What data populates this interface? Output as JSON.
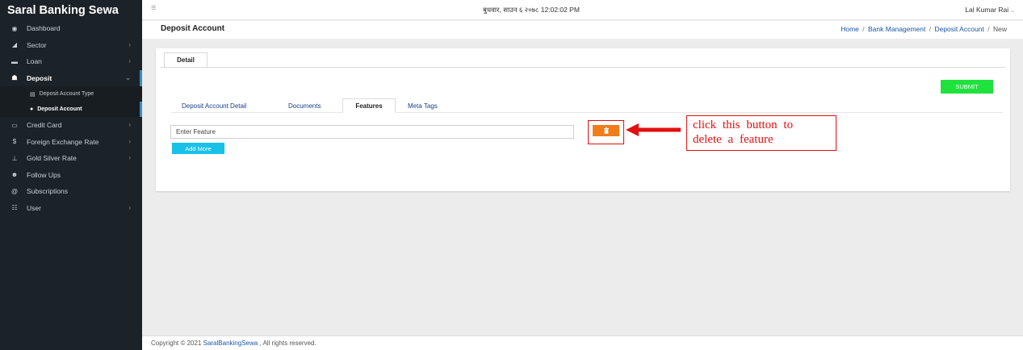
{
  "brand": "Saral Banking Sewa",
  "sidebar": {
    "items": [
      {
        "label": "Dashboard",
        "icon": "dashboard-icon"
      },
      {
        "label": "Sector",
        "icon": "sector-icon"
      },
      {
        "label": "Loan",
        "icon": "loan-icon"
      },
      {
        "label": "Deposit",
        "icon": "deposit-icon"
      },
      {
        "label": "Credit Card",
        "icon": "credit-card-icon"
      },
      {
        "label": "Foreign Exchange Rate",
        "icon": "dollar-icon"
      },
      {
        "label": "Gold Silver Rate",
        "icon": "gold-icon"
      },
      {
        "label": "Follow Ups",
        "icon": "follow-ups-icon"
      },
      {
        "label": "Subscriptions",
        "icon": "subscriptions-icon"
      },
      {
        "label": "User",
        "icon": "users-icon"
      }
    ],
    "subitems": [
      {
        "label": "Deposit Account Type",
        "icon": "card-icon"
      },
      {
        "label": "Deposit Account",
        "icon": "account-icon"
      }
    ]
  },
  "topbar": {
    "datetime": "बुधवार, साउन ६ २०७८ 12:02:02 PM",
    "user": "Lal Kumar Rai"
  },
  "page": {
    "title": "Deposit Account",
    "breadcrumb": [
      "Home",
      "Bank Management",
      "Deposit Account",
      "New"
    ]
  },
  "card": {
    "tab": "Detail",
    "submit": "SUBMIT",
    "subtabs": [
      "Deposit Account Detail",
      "Documents",
      "Features",
      "Meta Tags"
    ],
    "feature_placeholder": "Enter Feature",
    "add_more": "Add More",
    "callout_line1": "click this button to",
    "callout_line2": "delete a feature"
  },
  "footer": {
    "prefix": "Copyright © 2021 ",
    "link": "SaralBankingSewa",
    "suffix": " , All rights reserved."
  },
  "colors": {
    "sidebar_bg": "#1c2328",
    "submit": "#1fe23d",
    "add_more": "#17c1e8",
    "delete": "#f07d1a",
    "annotation": "#e01010",
    "link": "#1a56a8"
  }
}
